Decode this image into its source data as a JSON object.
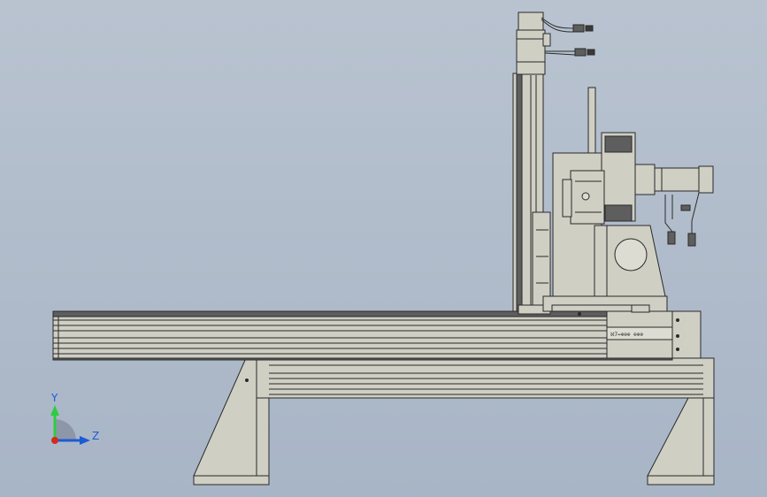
{
  "viewport": {
    "background_top": "#b9c3d0",
    "background_bottom": "#a8b5c6",
    "part_fill": "#cfcfc4",
    "part_shade": "#b8b8ad",
    "edge_color": "#2a2a2a",
    "dark_part": "#5e5e5e"
  },
  "triad": {
    "y_label": "Y",
    "z_label": "Z",
    "y_color": "#2ecc40",
    "z_color": "#1e5ad6",
    "x_color": "#d42a1e",
    "arc_color": "#8e97a8"
  },
  "plate_text": "ℵ7↔⊕⊕⊕ ⊕⊕⊕"
}
